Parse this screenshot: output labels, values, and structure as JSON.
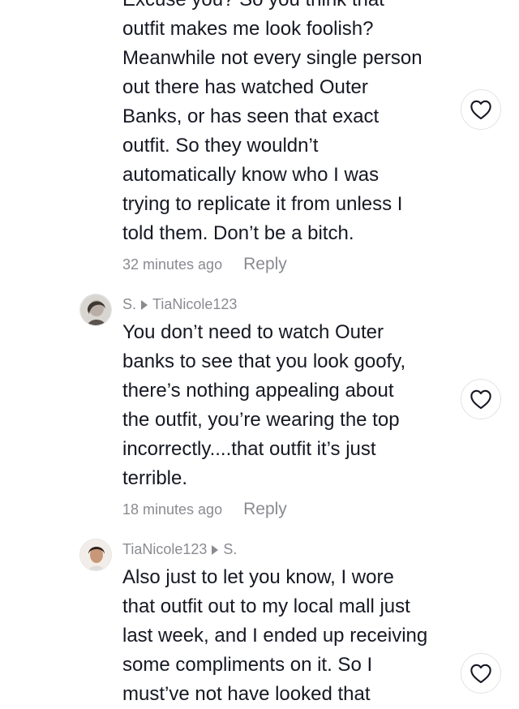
{
  "comments": [
    {
      "text": "Excuse you? So you think that\noutfit makes me look foolish?\nMeanwhile not every single person\nout there has watched Outer\nBanks, or has seen that exact\noutfit. So they wouldn’t\nautomatically know who I was\ntrying to replicate it from unless I\ntold them. Don’t be a bitch.",
      "time": "32 minutes ago",
      "reply_label": "Reply"
    },
    {
      "author": "S.",
      "reply_to": "TiaNicole123",
      "text": " You don’t need to watch Outer\nbanks to see that you look goofy,\nthere’s nothing appealing about\nthe outfit, you’re wearing the top\nincorrectly....that outfit it’s just\nterrible.",
      "time": "18 minutes ago",
      "reply_label": "Reply"
    },
    {
      "author": "TiaNicole123",
      "reply_to": "S.",
      "text": " Also just to let you know, I wore\nthat outfit out to my local mall just\nlast week, and I ended up receiving\nsome compliments on it. So I\nmust’ve not have looked that"
    }
  ],
  "icons": {
    "like": "heart-outline-icon",
    "reply_arrow": "triangle-right-icon"
  },
  "colors": {
    "text": "#161823",
    "muted": "#8a8b91",
    "border": "#e3e3e4"
  }
}
